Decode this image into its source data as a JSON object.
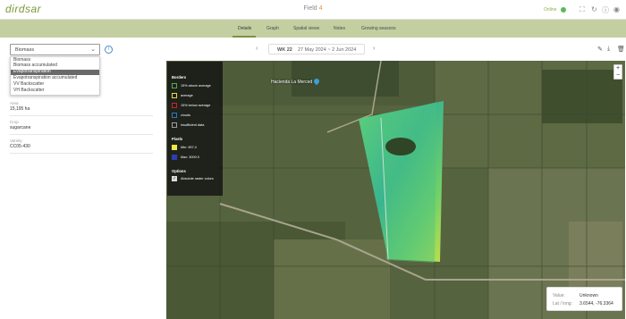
{
  "header": {
    "logo": "dirdsar",
    "field_title": "Field ",
    "field_number": "4",
    "status": "Online",
    "status_color": "#5cb85c",
    "icons": [
      "expand-icon",
      "refresh-icon",
      "sync-icon",
      "info-icon",
      "eye-icon"
    ]
  },
  "tabs": [
    {
      "label": "Details",
      "active": true
    },
    {
      "label": "Graph",
      "active": false
    },
    {
      "label": "Spatial views",
      "active": false
    },
    {
      "label": "Notes",
      "active": false
    },
    {
      "label": "Growing seasons",
      "active": false
    }
  ],
  "layer_select": {
    "value": "Biomass",
    "options": [
      "Biomass",
      "Biomass accumulated",
      "Evapotranspiration",
      "Evapotranspiration accumulated",
      "VV Backscatter",
      "VH Backscatter"
    ],
    "highlighted": "Evapotranspiration"
  },
  "properties": [
    {
      "label": "Area",
      "value": "15,195 ha"
    },
    {
      "label": "Crop",
      "value": "sugarcane"
    },
    {
      "label": "Variety",
      "value": "CC05-430"
    }
  ],
  "date_nav": {
    "week_label": "WK 22",
    "range": "27 May 2024 ~ 2 Jun 2024"
  },
  "legend": {
    "borders_title": "Borders",
    "borders": [
      {
        "label": "15% above average",
        "color": "#4caf50"
      },
      {
        "label": "average",
        "color": "#e8d84a"
      },
      {
        "label": "15% below average",
        "color": "#c62828"
      },
      {
        "label": "clouds",
        "color": "#2a7ac0"
      },
      {
        "label": "insufficient data",
        "color": "#9e9e9e"
      }
    ],
    "pixels_title": "Pixels",
    "pixels": [
      {
        "label": "Min: 957.4",
        "color": "#f2e64a"
      },
      {
        "label": "Max: 3000.0",
        "color": "#2b3fb0"
      }
    ],
    "options_title": "Options",
    "options": [
      {
        "label": "Absolute raster colors",
        "checked": true
      }
    ]
  },
  "map": {
    "place_name": "Hacienda La Merced",
    "zoom_in": "+",
    "zoom_out": "−"
  },
  "readout": {
    "value_label": "Value:",
    "value": "Unknown",
    "coord_label": "Lat / long:",
    "coord": "3.6544, -76.3364"
  }
}
